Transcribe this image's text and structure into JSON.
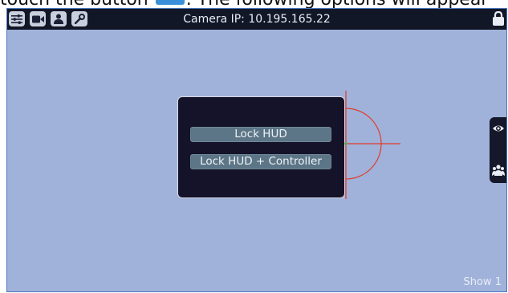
{
  "caption": {
    "text_before": "touch the button",
    "text_after": ". The following options will appear"
  },
  "topbar": {
    "camera_ip_label": "Camera IP: 10.195.165.22",
    "icons": [
      "sliders-icon",
      "video-camera-icon",
      "user-icon",
      "wrench-icon"
    ]
  },
  "lock_panel": {
    "lock_hud_label": "Lock HUD",
    "lock_hud_controller_label": "Lock HUD + Controller"
  },
  "side_tab": {
    "icons": [
      "eye-icon",
      "group-icon"
    ]
  },
  "status": {
    "show_label": "Show 1"
  },
  "colors": {
    "background": "#a0b2da",
    "topbar": "#121728",
    "panel": "#14132a",
    "button": "#5c7687",
    "crosshair": "#e03a2a"
  }
}
